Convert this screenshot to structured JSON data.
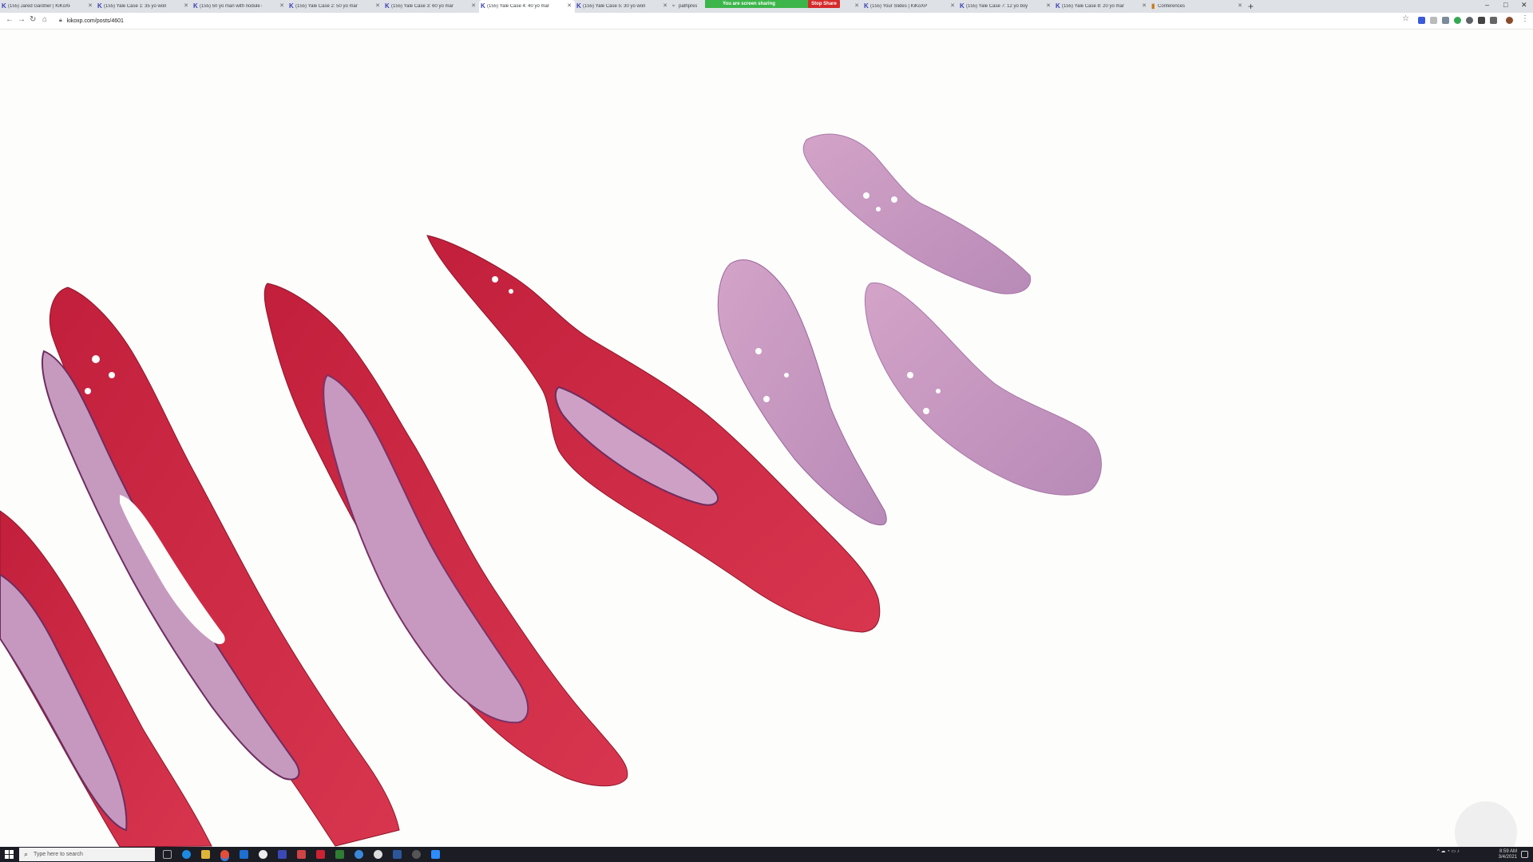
{
  "browser": {
    "tabs": [
      {
        "label": "(155) Jared Gardner | KiKoXP",
        "icon": "kikoxp-icon"
      },
      {
        "label": "(155) Yale Case 1: 35 yo woman",
        "icon": "kikoxp-icon"
      },
      {
        "label": "(155) 50 yo man with nodule ov",
        "icon": "kikoxp-icon"
      },
      {
        "label": "(155) Yale Case 2: 50 yo man wit",
        "icon": "kikoxp-icon"
      },
      {
        "label": "(155) Yale Case 3: 60 yo man wit",
        "icon": "kikoxp-icon"
      },
      {
        "label": "(155) Yale Case 4: 40 yo man wit",
        "icon": "kikoxp-icon",
        "active": true
      },
      {
        "label": "(155) Yale Case 5: 30 yo woman",
        "icon": "kikoxp-icon"
      },
      {
        "label": "pathpres",
        "icon": "pathpresenter-icon"
      },
      {
        "label": "(155) Your Slides | KiKoXP",
        "icon": "kikoxp-icon"
      },
      {
        "label": "(155) Yale Case 7: 12 yo boy wit",
        "icon": "kikoxp-icon"
      },
      {
        "label": "(155) Yale Case 8: 20 yo man wit",
        "icon": "kikoxp-icon"
      },
      {
        "label": "Conferences",
        "icon": "bookmark-icon"
      }
    ],
    "screen_share": {
      "banner_text": "You are screen sharing",
      "stop_label": "Stop Share"
    },
    "url": "kikoxp.com/posts/4601",
    "window_controls": {
      "minimize": "–",
      "maximize": "□",
      "close": "✕"
    },
    "colors": {
      "tab_strip": "#dee1e6",
      "share_green": "#3cb54a",
      "stop_red": "#d62a2a",
      "tissue_red": "#c8223a",
      "tissue_pink": "#c693bd"
    }
  },
  "viewer": {
    "content": "whole-slide histology image",
    "watermark": "circular logo watermark"
  },
  "taskbar": {
    "search_placeholder": "Type here to search",
    "time": "8:59 AM",
    "date": "3/4/2021"
  }
}
